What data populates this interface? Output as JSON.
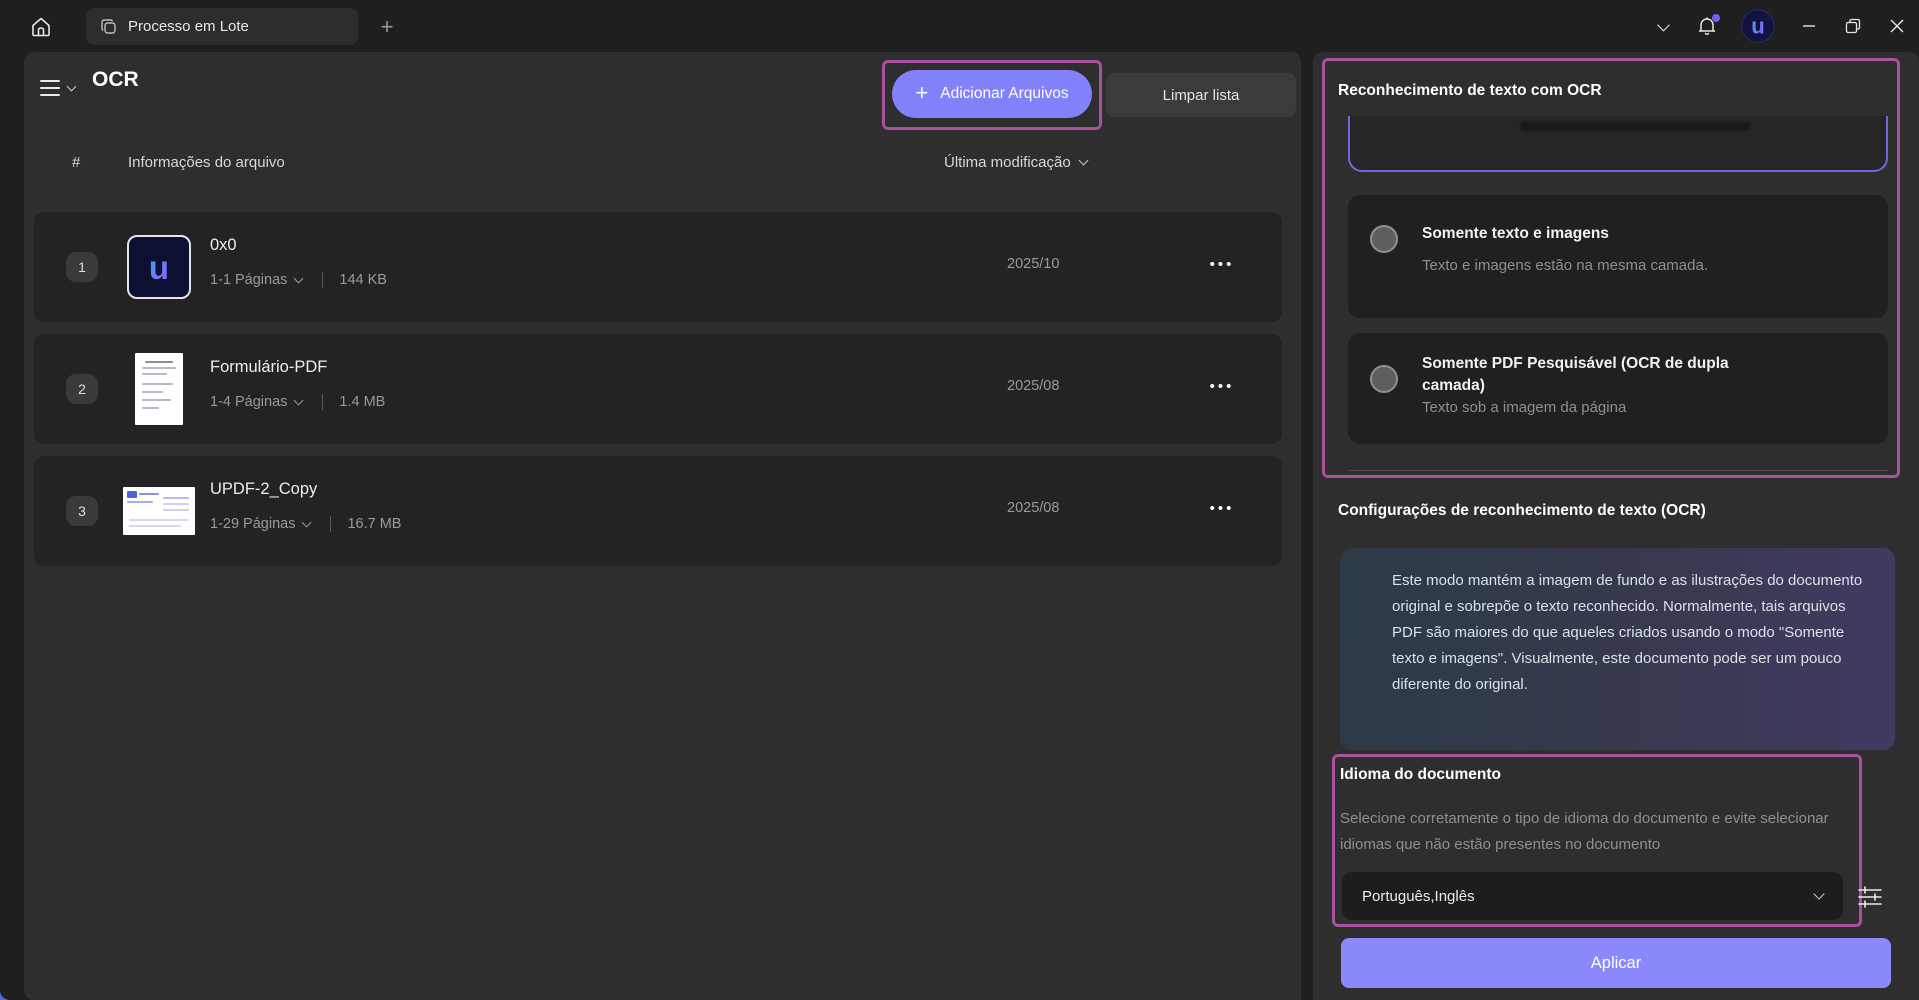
{
  "window": {
    "tab_title": "Processo em Lote"
  },
  "toolbar": {
    "title": "OCR",
    "add_files_label": "Adicionar Arquivos",
    "clear_list_label": "Limpar lista"
  },
  "file_list": {
    "columns": {
      "index": "#",
      "info": "Informações do arquivo",
      "modified": "Última modificação"
    },
    "rows": [
      {
        "index": "1",
        "name": "0x0",
        "pages": "1-1 Páginas",
        "size": "144 KB",
        "modified": "2025/10",
        "thumb": "updf-logo-thumbnail"
      },
      {
        "index": "2",
        "name": "Formulário-PDF",
        "pages": "1-4 Páginas",
        "size": "1.4 MB",
        "modified": "2025/08",
        "thumb": "document-portrait-thumbnail"
      },
      {
        "index": "3",
        "name": "UPDF-2_Copy",
        "pages": "1-29 Páginas",
        "size": "16.7 MB",
        "modified": "2025/08",
        "thumb": "document-landscape-thumbnail"
      }
    ]
  },
  "ocr_panel": {
    "title": "Reconhecimento de texto com OCR",
    "options": [
      {
        "title": "Somente texto e imagens",
        "subtitle": "Texto e imagens estão na mesma camada."
      },
      {
        "title": "Somente PDF Pesquisável (OCR de dupla camada)",
        "subtitle": "Texto sob a imagem da página"
      }
    ],
    "settings_title": "Configurações de reconhecimento de texto (OCR)",
    "tip_text": "Este modo mantém a imagem de fundo e as ilustrações do documento original e sobrepõe o texto reconhecido. Normalmente, tais arquivos PDF são maiores do que aqueles criados usando o modo \"Somente texto e imagens\". Visualmente, este documento pode ser um pouco diferente do original.",
    "language": {
      "title": "Idioma do documento",
      "description": "Selecione corretamente o tipo de idioma do documento e evite selecionar idiomas que não estão presentes no documento",
      "selected": "Português,Inglês"
    },
    "apply_label": "Aplicar"
  },
  "icons": {
    "plus": "+",
    "more": "•••"
  },
  "colors": {
    "accent": "#8381fa",
    "annotation_highlight": "#a8509e",
    "notification_dot": "#7a5cf0",
    "selected_option_border": "#6c6ade"
  }
}
